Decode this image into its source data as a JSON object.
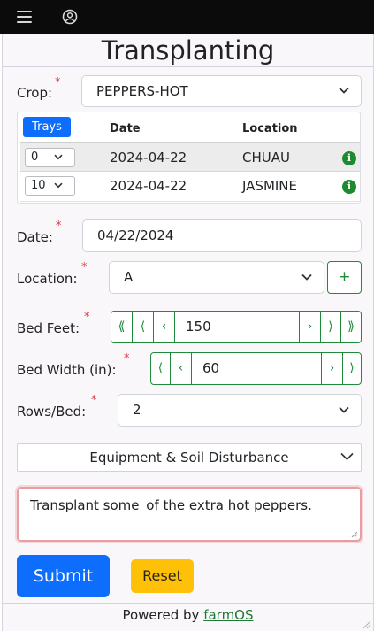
{
  "page": {
    "title": "Transplanting"
  },
  "topbar": {
    "menu_icon": "hamburger-icon",
    "account_icon": "user-circle-icon"
  },
  "crop": {
    "label": "Crop:",
    "required_mark": "*",
    "value": "PEPPERS-HOT"
  },
  "trays_table": {
    "button_label": "Trays",
    "headers": {
      "date": "Date",
      "location": "Location"
    },
    "rows": [
      {
        "trays": "0",
        "date": "2024-04-22",
        "location": "CHUAU",
        "info": "i"
      },
      {
        "trays": "10",
        "date": "2024-04-22",
        "location": "JASMINE",
        "info": "i"
      }
    ]
  },
  "date": {
    "label": "Date:",
    "required_mark": "*",
    "value": "04/22/2024"
  },
  "location": {
    "label": "Location:",
    "required_mark": "*",
    "value": "A",
    "add_label": "+"
  },
  "bed_feet": {
    "label": "Bed Feet:",
    "required_mark": "*",
    "value": "150",
    "dec_large": "⟪",
    "dec_medium": "⟨",
    "dec_small": "‹",
    "inc_small": "›",
    "inc_medium": "⟩",
    "inc_large": "⟫"
  },
  "bed_width": {
    "label": "Bed Width (in):",
    "required_mark": "*",
    "value": "60",
    "dec_medium": "⟨",
    "dec_small": "‹",
    "inc_small": "›",
    "inc_medium": "⟩"
  },
  "rows_bed": {
    "label": "Rows/Bed:",
    "required_mark": "*",
    "value": "2"
  },
  "equipment": {
    "label": "Equipment & Soil Disturbance"
  },
  "comment": {
    "before_caret": "Transplant some",
    "after_caret": " of the extra hot peppers."
  },
  "actions": {
    "submit": "Submit",
    "reset": "Reset"
  },
  "footer": {
    "prefix": "Powered by ",
    "link": "farmOS"
  },
  "colors": {
    "primary": "#0d6efd",
    "success": "#1e8a3a",
    "warning": "#ffc107",
    "danger": "#e03546",
    "topbar": "#0b0b0b"
  }
}
